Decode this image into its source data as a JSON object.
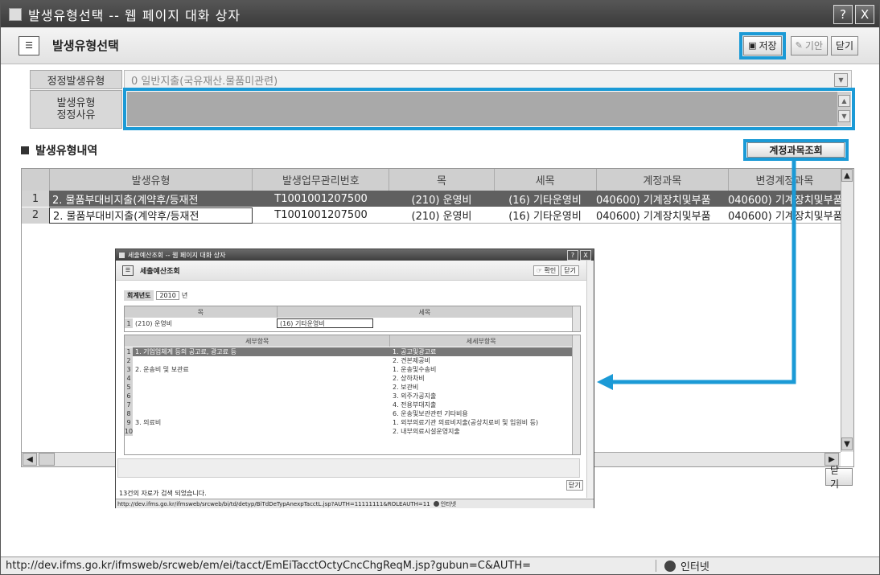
{
  "window": {
    "title": "발생유형선택 -- 웹 페이지 대화 상자",
    "help_btn": "?",
    "close_btn": "X",
    "header_title": "발생유형선택",
    "buttons": {
      "save": "저장",
      "draft": "기안",
      "close": "닫기"
    }
  },
  "form": {
    "correction_type_label": "정정발생유형",
    "correction_type_value": "0 일반지출(국유재산.물품미관련)",
    "reason_label_1": "발생유형",
    "reason_label_2": "정정사유",
    "reason_value": ""
  },
  "section": {
    "title": "발생유형내역",
    "lookup_button": "계정과목조회"
  },
  "grid": {
    "headers": [
      "발생유형",
      "발생업무관리번호",
      "목",
      "세목",
      "계정과목",
      "변경계정과목"
    ],
    "rows": [
      {
        "num": "1",
        "type": "2. 물품부대비지출(계약후/등재전",
        "mgmt": "T1001001207500",
        "mok": "(210) 운영비",
        "semok": "(16) 기타운영비",
        "account": "040600) 기계장치및부품",
        "new_account": "040600) 기계장치및부품"
      },
      {
        "num": "2",
        "type": "2. 물품부대비지출(계약후/등재전",
        "mgmt": "T1001001207500",
        "mok": "(210) 운영비",
        "semok": "(16) 기타운영비",
        "account": "040600) 기계장치및부품",
        "new_account": "040600) 기계장치및부품"
      }
    ],
    "close_button": "닫기"
  },
  "statusbar": {
    "url": "http://dev.ifms.go.kr/ifmsweb/srcweb/em/ei/tacct/EmEiTacctOctyCncChgReqM.jsp?gubun=C&AUTH=",
    "zone": "인터넷"
  },
  "dialog": {
    "title": "세출예산조회 -- 웹 페이지 대화 상자",
    "header_title": "세출예산조회",
    "confirm_button": "확인",
    "close_button": "닫기",
    "fiscal_year_label": "회계년도",
    "fiscal_year_value": "2010",
    "fiscal_year_suffix": "년",
    "top_headers": [
      "목",
      "세목"
    ],
    "top_rows": [
      {
        "num": "1",
        "mok": "(210) 운영비",
        "semok": "(16) 기타운영비"
      }
    ],
    "bottom_headers": [
      "세부항목",
      "세세부항목"
    ],
    "bottom_rows": [
      {
        "num": "1",
        "item": "1. 기업업체계 등의 공고료, 광고료 등",
        "sub": "1. 공고및광고료"
      },
      {
        "num": "2",
        "item": "",
        "sub": "2. 견본제공비"
      },
      {
        "num": "3",
        "item": "2. 운송비 및 보관료",
        "sub": "1. 운송및수송비"
      },
      {
        "num": "4",
        "item": "",
        "sub": "2. 상하차비"
      },
      {
        "num": "5",
        "item": "",
        "sub": "2. 보관비"
      },
      {
        "num": "6",
        "item": "",
        "sub": "3. 외주가공지출"
      },
      {
        "num": "7",
        "item": "",
        "sub": "4. 전용부대지출"
      },
      {
        "num": "8",
        "item": "",
        "sub": "6. 운송및보관관련 기타비용"
      },
      {
        "num": "9",
        "item": "3. 의료비",
        "sub": "1. 외부의료기관 의료비지출(공상치료비 및 입원비 등)"
      },
      {
        "num": "10",
        "item": "",
        "sub": "2. 내부의료시설운영지출"
      }
    ],
    "inner_close": "닫기",
    "result_text": "13건의 자료가 검색 되었습니다.",
    "status_url": "http://dev.ifms.go.kr/ifmsweb/srcweb/bi/td/detyp/BiTdDeTypAnexpTacctL.jsp?AUTH=11111111&ROLEAUTH=11",
    "status_zone": "인터넷"
  },
  "colors": {
    "highlight": "#1b9ad6",
    "selected_row": "#606060",
    "titlebar": "#3a3a3a"
  }
}
